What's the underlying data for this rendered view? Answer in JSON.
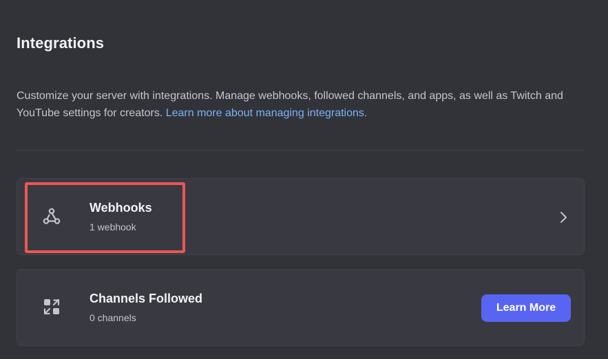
{
  "page": {
    "title": "Integrations",
    "description": "Customize your server with integrations. Manage webhooks, followed channels, and apps, as well as Twitch and YouTube settings for creators. ",
    "learn_link": "Learn more about managing integrations."
  },
  "webhooks_card": {
    "icon": "webhook-icon",
    "title": "Webhooks",
    "subtitle": "1 webhook",
    "chevron_icon": "chevron-right-icon"
  },
  "channels_card": {
    "icon": "channels-followed-icon",
    "title": "Channels Followed",
    "subtitle": "0 channels",
    "button_label": "Learn More"
  },
  "colors": {
    "background": "#323339",
    "card": "#393a41",
    "accent_button": "#5865f2",
    "link": "#7ab2f6",
    "highlight": "#ef5555"
  }
}
